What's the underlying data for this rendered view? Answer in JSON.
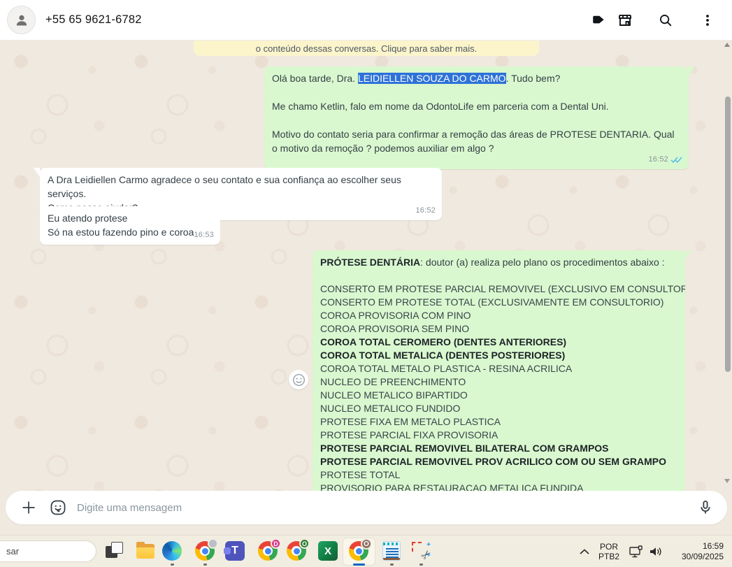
{
  "header": {
    "phone": "+55 65 9621-6782"
  },
  "banner": {
    "text": "o conteúdo dessas conversas. Clique para saber mais."
  },
  "chat": {
    "outgoing1": {
      "p1_prefix": "Olá boa tarde, Dra. ",
      "p1_highlight": "LEIDIELLEN SOUZA DO CARMO",
      "p1_suffix": ". Tudo bem?",
      "p2": "Me chamo Ketlin, falo em nome da OdontoLife em parceria com a Dental Uni.",
      "p3": "Motivo do contato seria para confirmar a remoção das áreas de  PROTESE DENTARIA. Qual o motivo da remoção ? podemos auxiliar em algo ?",
      "time": "16:52"
    },
    "incoming1": {
      "text": "A Dra Leidiellen Carmo agradece o seu contato e sua confiança ao escolher seus serviços.\nComo posso ajudar?",
      "time": "16:52"
    },
    "incoming2": {
      "text": "Eu atendo protese\nSó na estou fazendo pino e coroa",
      "time": "16:53"
    },
    "outgoing2": {
      "intro_bold": "PRÓTESE DENTÁRIA",
      "intro_rest": ": doutor (a) realiza pelo plano os procedimentos abaixo :",
      "items": [
        {
          "text": "CONSERTO EM PROTESE PARCIAL REMOVIVEL (EXCLUSIVO EM CONSULTORIO)",
          "bold": false
        },
        {
          "text": "CONSERTO EM PROTESE TOTAL (EXCLUSIVAMENTE EM CONSULTORIO)",
          "bold": false
        },
        {
          "text": "COROA PROVISORIA COM PINO",
          "bold": false
        },
        {
          "text": "COROA PROVISORIA SEM PINO",
          "bold": false
        },
        {
          "text": "COROA TOTAL CEROMERO (DENTES ANTERIORES)",
          "bold": true
        },
        {
          "text": "COROA TOTAL METALICA (DENTES POSTERIORES)",
          "bold": true
        },
        {
          "text": "COROA TOTAL METALO PLASTICA - RESINA ACRILICA",
          "bold": false
        },
        {
          "text": "NUCLEO DE PREENCHIMENTO",
          "bold": false
        },
        {
          "text": "NUCLEO METALICO BIPARTIDO",
          "bold": false
        },
        {
          "text": "NUCLEO METALICO FUNDIDO",
          "bold": false
        },
        {
          "text": "PROTESE FIXA EM METALO PLASTICA",
          "bold": false
        },
        {
          "text": "PROTESE PARCIAL FIXA PROVISORIA",
          "bold": false
        },
        {
          "text": "PROTESE PARCIAL REMOVIVEL BILATERAL COM GRAMPOS",
          "bold": true
        },
        {
          "text": "PROTESE PARCIAL REMOVIVEL PROV ACRILICO COM OU SEM GRAMPO",
          "bold": true
        },
        {
          "text": "PROTESE TOTAL",
          "bold": false
        },
        {
          "text": "PROVISORIO PARA RESTAURACAO METALICA FUNDIDA",
          "bold": false
        }
      ]
    }
  },
  "composer": {
    "placeholder": "Digite uma mensagem"
  },
  "taskbar": {
    "search_text": "sar",
    "badges": {
      "chrome2": "D",
      "chrome3": "O",
      "chrome_active": "O"
    },
    "excel_letter": "X",
    "teams_letter": "T",
    "language": {
      "line1": "POR",
      "line2": "PTB2"
    },
    "clock": {
      "time": "16:59",
      "date": "30/09/2025"
    }
  },
  "colors": {
    "outgoing_bubble": "#d9f8cf",
    "incoming_bubble": "#ffffff",
    "selection_highlight": "#2e72d8",
    "banner_bg": "#fcf4cb",
    "checkmark_blue": "#53bdeb",
    "taskbar_accent": "#0067c0"
  }
}
